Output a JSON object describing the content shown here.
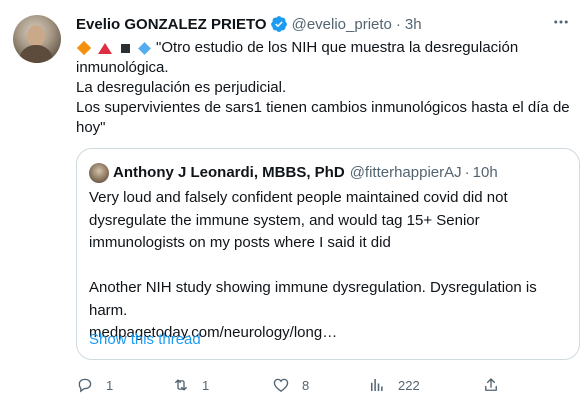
{
  "tweet": {
    "author_name": "Evelio GONZALEZ PRIETO",
    "handle": "@evelio_prieto",
    "separator": "·",
    "time": "3h",
    "emoji_icons": [
      "large-orange-diamond-icon",
      "red-triangle-icon",
      "black-small-square-icon",
      "small-blue-diamond-icon"
    ],
    "lines": [
      "\"Otro estudio de los NIH que muestra la desregulación",
      "inmunológica.",
      "La desregulación es perjudicial.",
      "Los supervivientes de sars1 tienen cambios inmunológicos hasta el día de",
      "hoy\""
    ]
  },
  "quote": {
    "author_name": "Anthony J Leonardi, MBBS, PhD",
    "handle": "@fitterhappierAJ",
    "separator": "·",
    "time": "10h",
    "lines": [
      "Very loud and falsely confident people maintained covid did not",
      "dysregulate the immune system, and would tag 15+ Senior",
      "immunologists on my posts where I said it did",
      "",
      "Another NIH study showing immune dysregulation. Dysregulation is",
      "harm.",
      "medpagetoday.com/neurology/long…"
    ],
    "show_thread": "Show this thread"
  },
  "actions": {
    "replies": "1",
    "retweets": "1",
    "likes": "8",
    "views": "222"
  },
  "colors": {
    "link": "#1d9bf0",
    "secondary_text": "#536471",
    "verified_badge": "#1d9bf0",
    "border": "#cfd9de"
  }
}
